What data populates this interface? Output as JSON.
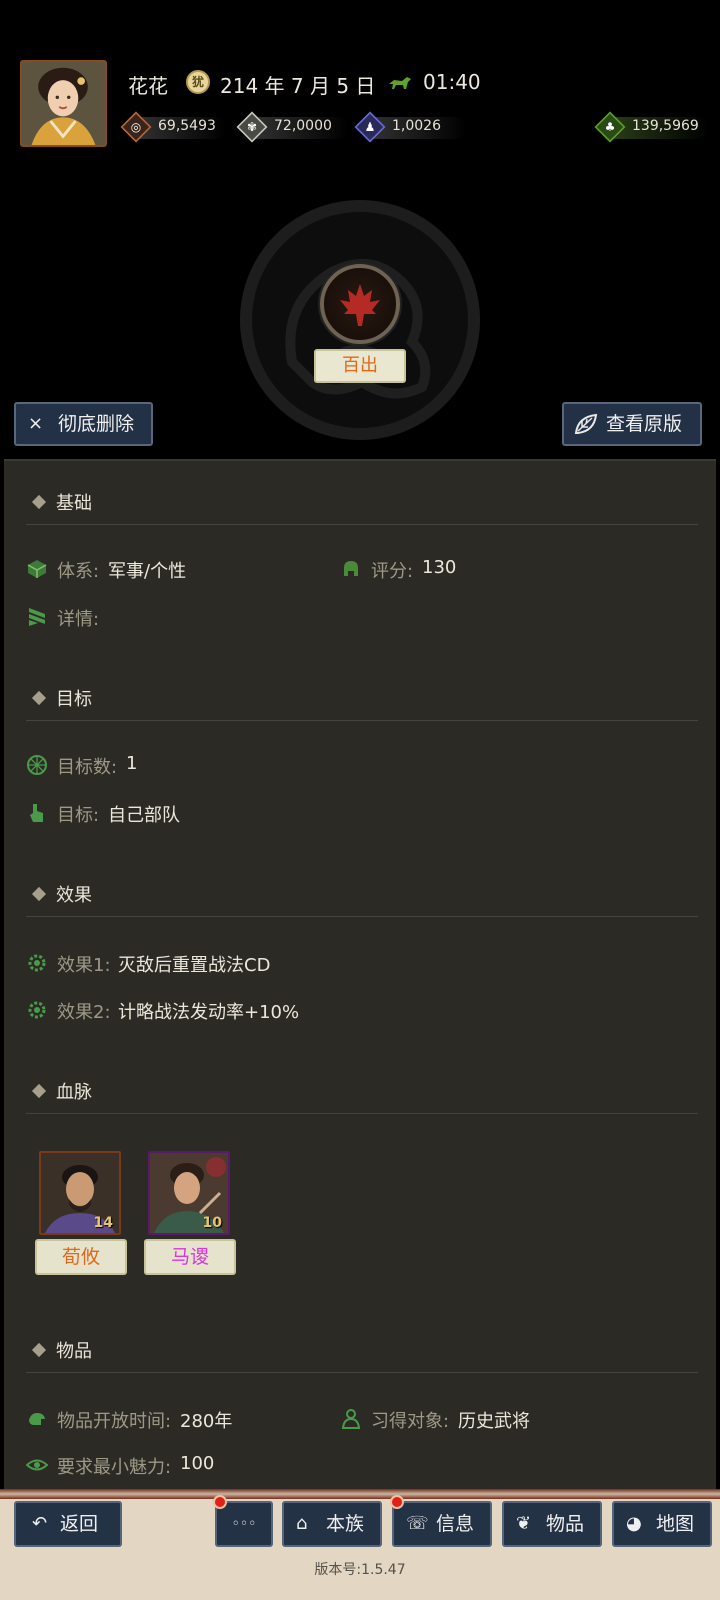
{
  "header": {
    "player_name": "花花",
    "date_icon_glyph": "犹",
    "date": "214 年 7 月 5 日",
    "time": "01:40",
    "resources": [
      {
        "name": "money",
        "icon": "coin-icon",
        "color": "#b5673a",
        "value": "69,5493"
      },
      {
        "name": "grain",
        "icon": "grain-icon",
        "color": "#c8c8c0",
        "value": "72,0000"
      },
      {
        "name": "troops",
        "icon": "soldier-icon",
        "color": "#6a6ad8",
        "value": "1,0026"
      },
      {
        "name": "supply",
        "icon": "bag-icon",
        "color": "#5aa02a",
        "value": "139,5969"
      }
    ]
  },
  "tactic": {
    "name": "百出",
    "name_color": "#e06a1a"
  },
  "actions": {
    "delete_icon": "×",
    "delete_label": "彻底删除",
    "view_original_label": "查看原版"
  },
  "sections": {
    "basic": {
      "title": "基础",
      "system_key": "体系:",
      "system_value": "军事/个性",
      "score_key": "评分:",
      "score_value": "130",
      "detail_key": "详情:"
    },
    "target": {
      "title": "目标",
      "count_key": "目标数:",
      "count_value": "1",
      "target_key": "目标:",
      "target_value": "自己部队"
    },
    "effect": {
      "title": "效果",
      "e1_key": "效果1:",
      "e1_value": "灭敌后重置战法CD",
      "e2_key": "效果2:",
      "e2_value": "计略战法发动率+10%"
    },
    "bloodline": {
      "title": "血脉",
      "heroes": [
        {
          "name": "荀攸",
          "level": "14",
          "name_color": "#e06a1a",
          "frame_color": "#7a3a1a"
        },
        {
          "name": "马谡",
          "level": "10",
          "name_color": "#d838d8",
          "frame_color": "#5a1a6a"
        }
      ]
    },
    "item": {
      "title": "物品",
      "open_key": "物品开放时间:",
      "open_value": "280年",
      "learn_key": "习得对象:",
      "learn_value": "历史武将",
      "charm_key": "要求最小魅力:",
      "charm_value": "100"
    }
  },
  "nav": {
    "back_icon": "↶",
    "back": "返回",
    "more": "◦◦◦",
    "clan": "本族",
    "info": "信息",
    "items": "物品",
    "map": "地图",
    "version": "版本号:1.5.47"
  }
}
